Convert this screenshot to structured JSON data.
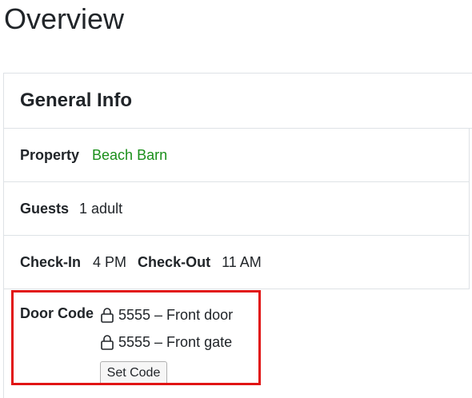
{
  "page": {
    "title": "Overview"
  },
  "general_info": {
    "title": "General Info",
    "property": {
      "label": "Property",
      "value": "Beach Barn"
    },
    "guests": {
      "label": "Guests",
      "value": "1 adult"
    },
    "check_in": {
      "label": "Check-In",
      "value": "4 PM"
    },
    "check_out": {
      "label": "Check-Out",
      "value": "11 AM"
    },
    "door_code": {
      "label": "Door Code",
      "codes": [
        {
          "icon": "lock-icon",
          "text": "5555 – Front door"
        },
        {
          "icon": "lock-icon",
          "text": "5555 – Front gate"
        }
      ],
      "button_label": "Set Code"
    }
  },
  "colors": {
    "link": "#1a8f1a",
    "highlight": "#e11414",
    "border": "#dee2e6"
  }
}
